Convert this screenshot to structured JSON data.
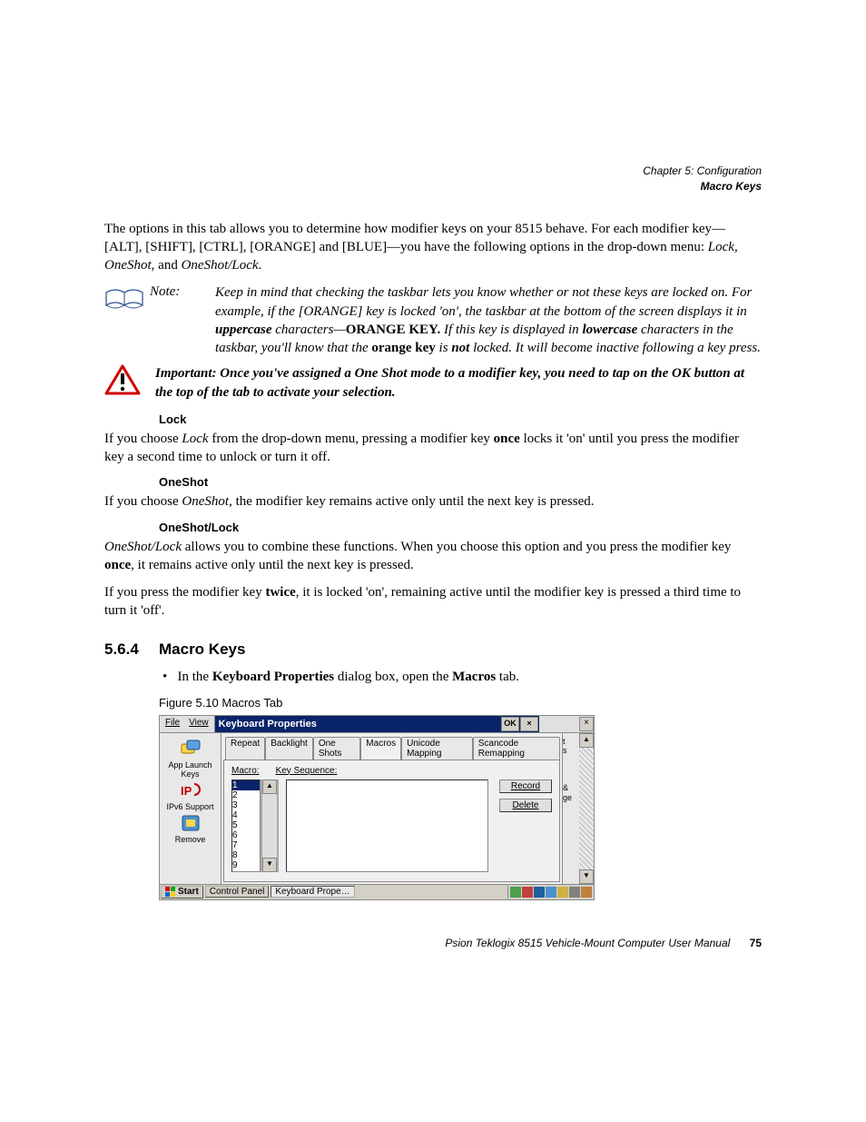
{
  "header": {
    "chapter": "Chapter 5: Configuration",
    "section": "Macro Keys"
  },
  "para_intro": "The options in this tab allows you to determine how modifier keys on your 8515 behave. For each modifier key—[ALT], [SHIFT], [CTRL], [ORANGE] and [BLUE]—you have the following options in the drop-down menu: ",
  "intro_em1": "Lock",
  "intro_sep1": ", ",
  "intro_em2": "OneShot",
  "intro_sep2": ", and ",
  "intro_em3": "OneShot/Lock",
  "intro_end": ".",
  "note": {
    "label": "Note:",
    "t1": "Keep in mind that checking the taskbar lets you know whether or not these keys are locked on. For example, if the [ORANGE] key is locked 'on', the taskbar at the bottom of the screen displays it in ",
    "b1": "uppercase",
    "t2": " characters—",
    "b2": "ORANGE KEY.",
    "t3": " If this key is displayed in ",
    "b3": "lowercase",
    "t4": " characters in the taskbar, you'll know that the ",
    "b4": "orange key",
    "t5": " is ",
    "b5": "not",
    "t6": " locked. It will become inactive following a key press."
  },
  "important": {
    "label": "Important: ",
    "text": "Once you've assigned a One Shot mode to a modifier key, you need to tap on the OK button at the top of the tab to activate your selection."
  },
  "lock_head": "Lock",
  "lock_t1": "If you choose ",
  "lock_em": "Lock",
  "lock_t2": " from the drop-down menu, pressing a modifier key ",
  "lock_b": "once",
  "lock_t3": " locks it 'on' until you press the modifier key a second time to unlock or turn it off.",
  "oneshot_head": "OneShot",
  "oneshot_t1": "If you choose ",
  "oneshot_em": "OneShot",
  "oneshot_t2": ", the modifier key remains active only until the next key is pressed.",
  "osl_head": "OneShot/Lock",
  "osl_em": "OneShot/Lock",
  "osl_t1": " allows you to combine these functions. When you choose this option and you press the modifier key ",
  "osl_b1": "once",
  "osl_t2": ", it remains active only until the next key is pressed.",
  "osl2_t1": "If you press the modifier key ",
  "osl2_b": "twice",
  "osl2_t2": ", it is locked 'on', remaining active until the modifier key is pressed a third time to turn it 'off'.",
  "section": {
    "num": "5.6.4",
    "title": "Macro Keys"
  },
  "bullet_t1": "In the ",
  "bullet_b1": "Keyboard Properties",
  "bullet_t2": " dialog box, open the ",
  "bullet_b2": "Macros",
  "bullet_t3": " tab.",
  "fig_caption": "Figure 5.10 Macros Tab",
  "figure": {
    "menu_file": "File",
    "menu_view": "View",
    "window_title": "Keyboard Properties",
    "ok": "OK",
    "tabs": [
      "Repeat",
      "Backlight",
      "One Shots",
      "Macros",
      "Unicode Mapping",
      "Scancode Remapping"
    ],
    "active_tab_index": 3,
    "macro_label": "Macro:",
    "keyseq_label": "Key Sequence:",
    "macro_items": [
      "1",
      "2",
      "3",
      "4",
      "5",
      "6",
      "7",
      "8",
      "9"
    ],
    "record_btn": "Record",
    "delete_btn": "Delete",
    "desktop": {
      "item1": "App Launch Keys",
      "item2": "IPv6 Support",
      "item3": "Remove"
    },
    "taskbar": {
      "start": "Start",
      "control_panel": "Control Panel",
      "kbd_props": "Keyboard Prope…"
    },
    "right_hint1": "t",
    "right_hint2": "s",
    "right_hint3": "&",
    "right_hint4": "ge"
  },
  "footer": {
    "text": "Psion Teklogix 8515 Vehicle-Mount Computer User Manual",
    "page": "75"
  }
}
